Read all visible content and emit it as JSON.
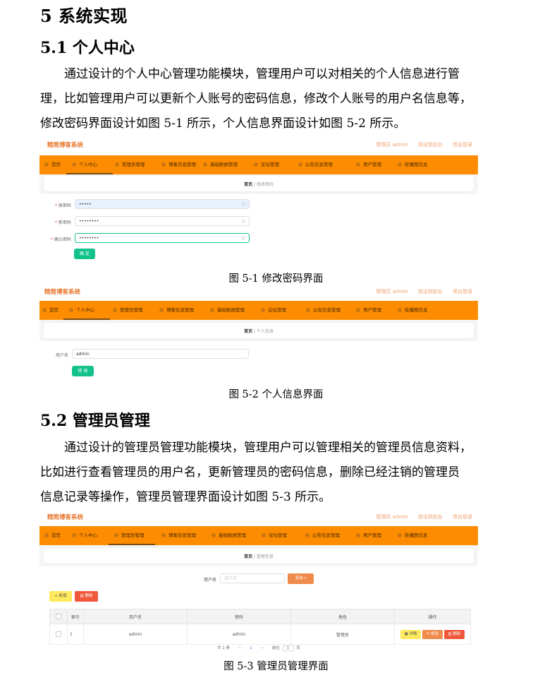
{
  "heading1": "5 系统实现",
  "s51": {
    "title": "5.1 个人中心",
    "para": [
      "　　通过设计的个人中心管理功能模块，管理用户可以对相关的个人信息进行管",
      "理，比如管理用户可以更新个人账号的密码信息，修改个人账号的用户名信息等，",
      "修改密码界面设计如图 5-1 所示，个人信息界面设计如图 5-2 所示。"
    ],
    "fig1_caption": "图 5-1 修改密码界面",
    "fig2_caption": "图 5-2 个人信息界面"
  },
  "s52": {
    "title": "5.2 管理员管理",
    "para": [
      "　　通过设计的管理员管理功能模块，管理用户可以管理相关的管理员信息资料，",
      "比如进行查看管理员的用户名，更新管理员的密码信息，删除已经注销的管理员",
      "信息记录等操作，管理员管理界面设计如图 5-3 所示。"
    ],
    "fig3_caption": "图 5-3 管理员管理界面"
  },
  "app": {
    "brand": "精简博客系统",
    "top_links": [
      "管理员 admin",
      "退出到前台",
      "退出登录"
    ],
    "nav": [
      "首页",
      "个人中心",
      "管理员管理",
      "博客信息管理",
      "基础数据管理",
      "论坛管理",
      "公告信息管理",
      "用户管理",
      "轮播图信息"
    ]
  },
  "fig1": {
    "crumb_home": "首页",
    "crumb_page": "修改密码",
    "labels": [
      "原密码",
      "新密码",
      "确认密码"
    ],
    "values": [
      "•••••",
      "••••••••",
      "••••••••"
    ],
    "submit": "确 定"
  },
  "fig2": {
    "crumb_home": "首页",
    "crumb_page": "个人信息",
    "username_label": "用户名",
    "username_value": "admin",
    "submit": "修 改"
  },
  "fig3": {
    "crumb_home": "首页",
    "crumb_page": "管理信息",
    "search_label": "用户名",
    "search_placeholder": "用户名",
    "search_button": "查询 ⌕",
    "add_button": "+ 新增",
    "delete_button": "▥ 删除",
    "columns": [
      "",
      "索引",
      "用户名",
      "密码",
      "角色",
      "操作"
    ],
    "rows": [
      {
        "index": "1",
        "username": "admin",
        "password": "admin",
        "role": "管理员"
      }
    ],
    "row_actions": [
      "▣ 详情",
      "✎ 修改",
      "▥ 删除"
    ],
    "pagination": {
      "total": "共 1 条",
      "prev": "<",
      "page": "1",
      "next": ">",
      "goto": "前往",
      "goto_page": "1",
      "unit": "页"
    }
  }
}
